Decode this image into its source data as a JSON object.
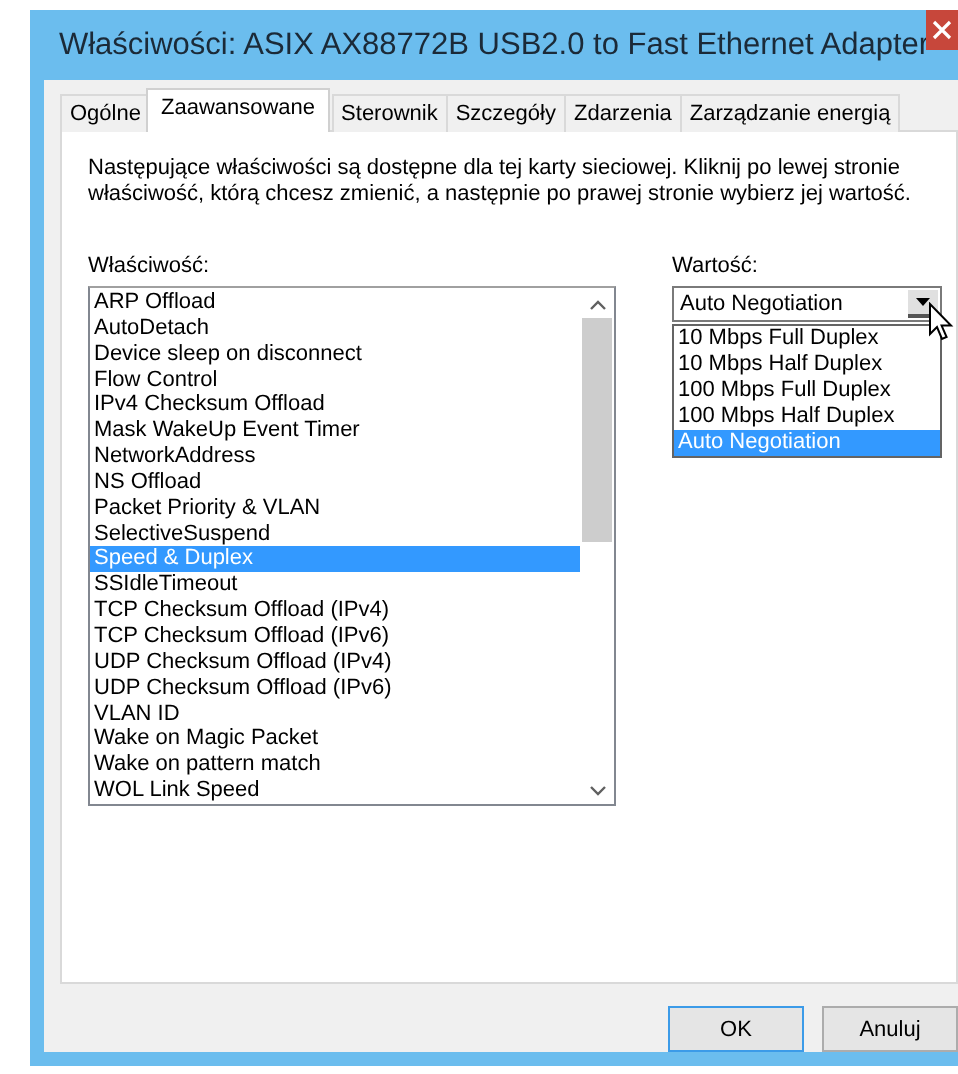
{
  "window": {
    "title": "Właściwości: ASIX AX88772B USB2.0 to Fast Ethernet Adapter"
  },
  "tabs": [
    {
      "label": "Ogólne",
      "selected": false
    },
    {
      "label": "Zaawansowane",
      "selected": true
    },
    {
      "label": "Sterownik",
      "selected": false
    },
    {
      "label": "Szczegóły",
      "selected": false
    },
    {
      "label": "Zdarzenia",
      "selected": false
    },
    {
      "label": "Zarządzanie energią",
      "selected": false
    }
  ],
  "description": "Następujące właściwości są dostępne dla tej karty sieciowej. Kliknij po lewej stronie właściwość, którą chcesz zmienić, a następnie po prawej stronie wybierz jej wartość.",
  "property": {
    "label": "Właściwość:",
    "items": [
      {
        "label": "ARP Offload",
        "selected": false
      },
      {
        "label": "AutoDetach",
        "selected": false
      },
      {
        "label": "Device sleep on disconnect",
        "selected": false
      },
      {
        "label": "Flow Control",
        "selected": false
      },
      {
        "label": "IPv4 Checksum Offload",
        "selected": false
      },
      {
        "label": "Mask WakeUp Event Timer",
        "selected": false
      },
      {
        "label": "NetworkAddress",
        "selected": false
      },
      {
        "label": "NS Offload",
        "selected": false
      },
      {
        "label": "Packet Priority & VLAN",
        "selected": false
      },
      {
        "label": "SelectiveSuspend",
        "selected": false
      },
      {
        "label": "Speed & Duplex",
        "selected": true
      },
      {
        "label": "SSIdleTimeout",
        "selected": false
      },
      {
        "label": "TCP Checksum Offload (IPv4)",
        "selected": false
      },
      {
        "label": "TCP Checksum Offload (IPv6)",
        "selected": false
      },
      {
        "label": "UDP Checksum Offload (IPv4)",
        "selected": false
      },
      {
        "label": "UDP Checksum Offload (IPv6)",
        "selected": false
      },
      {
        "label": "VLAN ID",
        "selected": false
      },
      {
        "label": "Wake on Magic Packet",
        "selected": false
      },
      {
        "label": "Wake on pattern match",
        "selected": false
      },
      {
        "label": "WOL Link Speed",
        "selected": false
      }
    ]
  },
  "value": {
    "label": "Wartość:",
    "value": "Auto Negotiation",
    "expanded": true,
    "options": [
      {
        "label": "10 Mbps Full Duplex",
        "selected": false
      },
      {
        "label": "10 Mbps Half Duplex",
        "selected": false
      },
      {
        "label": "100 Mbps Full Duplex",
        "selected": false
      },
      {
        "label": "100 Mbps Half Duplex",
        "selected": false
      },
      {
        "label": "Auto Negotiation",
        "selected": true
      }
    ]
  },
  "buttons": [
    "OK",
    "Anuluj"
  ]
}
